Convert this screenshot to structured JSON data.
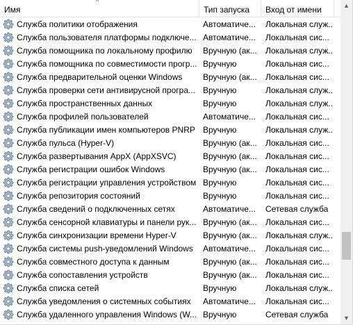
{
  "columns": {
    "name": "Имя",
    "startup": "Тип запуска",
    "logon": "Вход от имени"
  },
  "rows": [
    {
      "name": "Служба политики отображения",
      "startup": "Автоматиче...",
      "logon": "Локальная служ..."
    },
    {
      "name": "Служба пользователя платформы подключе...",
      "startup": "Автоматиче...",
      "logon": "Локальная сис..."
    },
    {
      "name": "Служба помощника по локальному профилю",
      "startup": "Вручную (ак...",
      "logon": "Локальная служ..."
    },
    {
      "name": "Служба помощника по совместимости прогр...",
      "startup": "Вручную",
      "logon": "Локальная сис..."
    },
    {
      "name": "Служба предварительной оценки Windows",
      "startup": "Вручную (ак...",
      "logon": "Локальная сис..."
    },
    {
      "name": "Служба проверки сети антивирусной програ...",
      "startup": "Вручную",
      "logon": "Локальная служ..."
    },
    {
      "name": "Служба пространственных данных",
      "startup": "Вручную",
      "logon": "Локальная служ..."
    },
    {
      "name": "Служба профилей пользователей",
      "startup": "Автоматиче...",
      "logon": "Локальная сис..."
    },
    {
      "name": "Служба публикации имен компьютеров PNRP",
      "startup": "Вручную",
      "logon": "Локальная служ..."
    },
    {
      "name": "Служба пульса (Hyper-V)",
      "startup": "Вручную (ак...",
      "logon": "Локальная сис..."
    },
    {
      "name": "Служба развертывания AppX (AppXSVC)",
      "startup": "Вручную (ак...",
      "logon": "Локальная сис..."
    },
    {
      "name": "Служба регистрации ошибок Windows",
      "startup": "Вручную (ак...",
      "logon": "Локальная сис..."
    },
    {
      "name": "Служба регистрации управления устройством",
      "startup": "Вручную",
      "logon": "Локальная сис..."
    },
    {
      "name": "Служба репозитория состояний",
      "startup": "Вручную",
      "logon": "Локальная сис..."
    },
    {
      "name": "Служба сведений о подключенных сетях",
      "startup": "Автоматиче...",
      "logon": "Сетевая служба"
    },
    {
      "name": "Служба сенсорной клавиатуры и панели рук...",
      "startup": "Вручную (ак...",
      "logon": "Локальная сис..."
    },
    {
      "name": "Служба синхронизации времени Hyper-V",
      "startup": "Вручную (ак...",
      "logon": "Локальная служ..."
    },
    {
      "name": "Служба системы push-уведомлений Windows",
      "startup": "Автоматиче...",
      "logon": "Локальная сис..."
    },
    {
      "name": "Служба совместного доступа к данным",
      "startup": "Вручную (ак...",
      "logon": "Локальная сис..."
    },
    {
      "name": "Служба сопоставления устройств",
      "startup": "Вручную (ак...",
      "logon": "Локальная сис..."
    },
    {
      "name": "Служба списка сетей",
      "startup": "Вручную",
      "logon": "Локальная служ..."
    },
    {
      "name": "Служба уведомления о системных событиях",
      "startup": "Автоматиче...",
      "logon": "Локальная сис..."
    },
    {
      "name": "Служба удаленного управления Windows (W...",
      "startup": "Вручную",
      "logon": "Сетевая служба"
    }
  ],
  "row_icon": "gear-icon",
  "sort_indicator": "^",
  "scrollbar": {
    "up": "▲",
    "down": "▼"
  },
  "colors": {
    "gear_fill": "#a7b7c4",
    "gear_stroke": "#5f7a90",
    "header_separator": "#e5e5e5"
  }
}
